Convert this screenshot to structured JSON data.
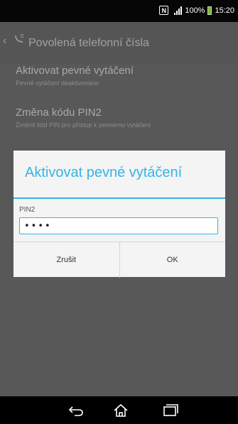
{
  "status_bar": {
    "battery_text": "100%",
    "time": "15:20",
    "nfc_label": "N",
    "icons": [
      "nfc-icon",
      "signal-icon",
      "battery-icon"
    ]
  },
  "action_bar": {
    "title": "Povolená telefonní čísla",
    "back_icon": "chevron-left-icon",
    "app_icon": "phone-icon"
  },
  "settings": {
    "items": [
      {
        "title": "Aktivovat pevné vytáčení",
        "subtitle": "Pevné vytáčení deaktivováno"
      },
      {
        "title": "Změna kódu PIN2",
        "subtitle": "Změnit kód PIN pro přístup k pevnému vytáčení"
      }
    ]
  },
  "dialog": {
    "title": "Aktivovat pevné vytáčení",
    "field_label": "PIN2",
    "pin_value": "••••",
    "cancel_label": "Zrušit",
    "ok_label": "OK"
  },
  "nav_bar": {
    "icons": [
      "back-icon",
      "home-icon",
      "recent-apps-icon"
    ]
  },
  "colors": {
    "accent": "#33b5e5",
    "dim_background": "#585858",
    "battery": "#7ab92c"
  }
}
